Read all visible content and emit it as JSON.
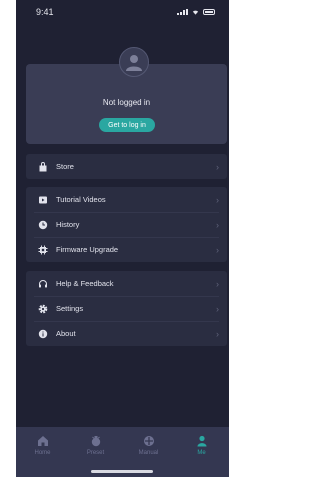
{
  "status_bar": {
    "time": "9:41"
  },
  "profile": {
    "status_text": "Not logged in",
    "login_button": "Get to log in"
  },
  "menu_groups": [
    [
      {
        "label": "Store",
        "icon": "bag-icon"
      }
    ],
    [
      {
        "label": "Tutorial Videos",
        "icon": "play-icon"
      },
      {
        "label": "History",
        "icon": "clock-icon"
      },
      {
        "label": "Firmware Upgrade",
        "icon": "chip-icon"
      }
    ],
    [
      {
        "label": "Help & Feedback",
        "icon": "headset-icon"
      },
      {
        "label": "Settings",
        "icon": "gear-icon"
      },
      {
        "label": "About",
        "icon": "info-icon"
      }
    ]
  ],
  "tabs": [
    {
      "label": "Home",
      "icon": "house-icon",
      "active": false
    },
    {
      "label": "Preset",
      "icon": "flask-icon",
      "active": false
    },
    {
      "label": "Manual",
      "icon": "crosshair-icon",
      "active": false
    },
    {
      "label": "Me",
      "icon": "person-icon",
      "active": true
    }
  ],
  "colors": {
    "background": "#1f2133",
    "card": "#2a2d41",
    "accent": "#2aa7a1"
  }
}
